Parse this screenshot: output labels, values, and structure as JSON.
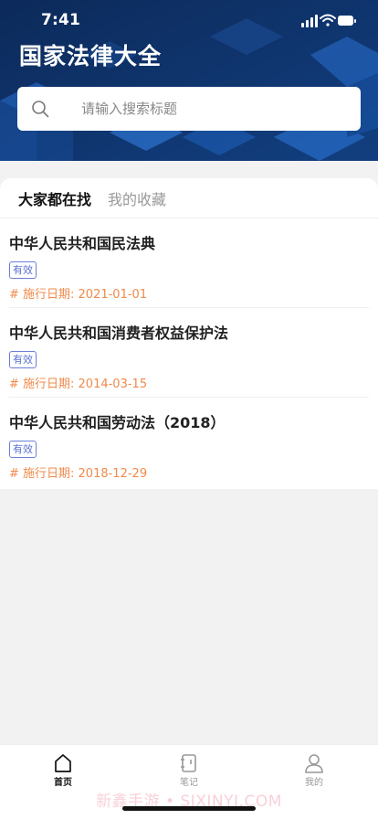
{
  "status_bar": {
    "time": "7:41"
  },
  "header": {
    "title": "国家法律大全",
    "search": {
      "placeholder": "请输入搜索标题",
      "value": ""
    }
  },
  "tabs": [
    {
      "label": "大家都在找",
      "active": true
    },
    {
      "label": "我的收藏",
      "active": false
    }
  ],
  "laws": [
    {
      "title": "中华人民共和国民法典",
      "badge": "有效",
      "date": "# 施行日期: 2021-01-01"
    },
    {
      "title": "中华人民共和国消费者权益保护法",
      "badge": "有效",
      "date": "# 施行日期: 2014-03-15"
    },
    {
      "title": "中华人民共和国劳动法（2018）",
      "badge": "有效",
      "date": "# 施行日期: 2018-12-29"
    }
  ],
  "tabbar": [
    {
      "label": "首页",
      "icon": "home-icon",
      "active": true
    },
    {
      "label": "笔记",
      "icon": "notebook-icon",
      "active": false
    },
    {
      "label": "我的",
      "icon": "person-icon",
      "active": false
    }
  ],
  "watermark": "新鑫手游 • SIXINYI.COM",
  "colors": {
    "header_bg": "#0f2f63",
    "badge": "#5a6fd0",
    "date": "#f08a4b"
  }
}
